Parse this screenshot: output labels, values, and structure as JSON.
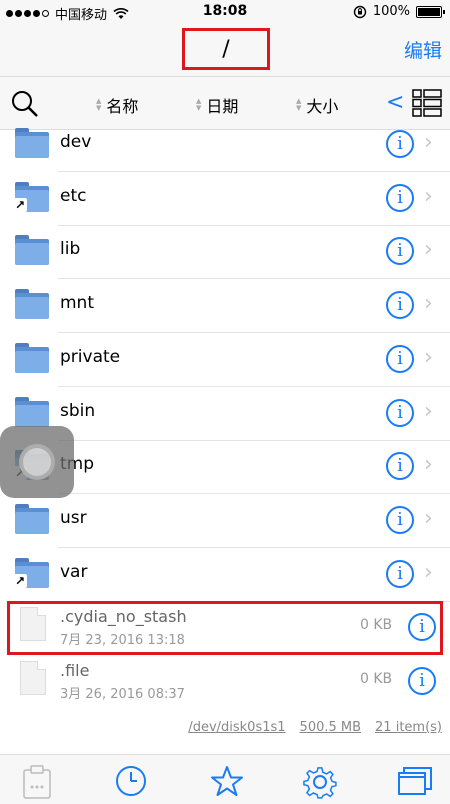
{
  "status": {
    "carrier": "中国移动",
    "time": "18:08",
    "battery": "100%"
  },
  "nav": {
    "title": "/",
    "edit_label": "编辑"
  },
  "toolbar": {
    "sort_name": "名称",
    "sort_date": "日期",
    "sort_size": "大小",
    "back_glyph": "<"
  },
  "folders": [
    {
      "name": "dev",
      "symlink": false
    },
    {
      "name": "etc",
      "symlink": true
    },
    {
      "name": "lib",
      "symlink": false
    },
    {
      "name": "mnt",
      "symlink": false
    },
    {
      "name": "private",
      "symlink": false
    },
    {
      "name": "sbin",
      "symlink": false
    },
    {
      "name": "tmp",
      "symlink": true
    },
    {
      "name": "usr",
      "symlink": false
    },
    {
      "name": "var",
      "symlink": true
    }
  ],
  "files": [
    {
      "name": ".cydia_no_stash",
      "date": "7月 23, 2016 13:18",
      "size": "0 KB"
    },
    {
      "name": ".file",
      "date": "3月 26, 2016 08:37",
      "size": "0 KB"
    }
  ],
  "footer": {
    "disk": "/dev/disk0s1s1",
    "capacity": "500.5 MB",
    "count": "21 item(s)"
  },
  "colors": {
    "accent": "#1a7cf5",
    "highlight": "#e0161e"
  }
}
